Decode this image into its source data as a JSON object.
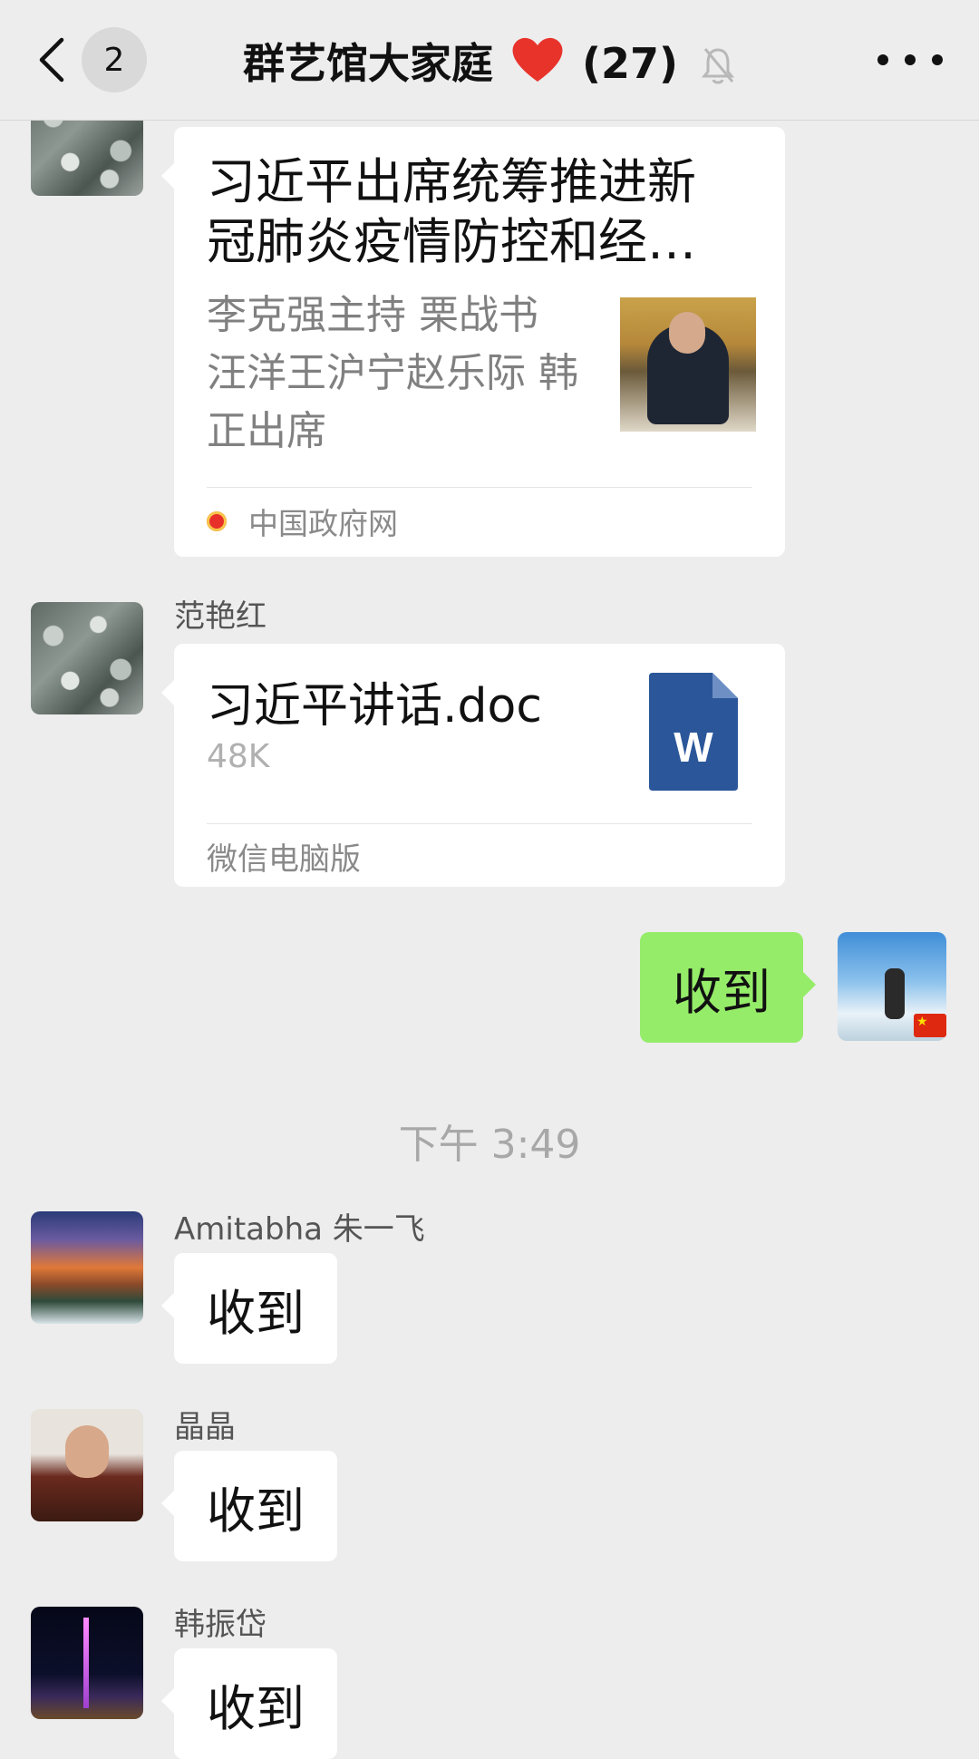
{
  "header": {
    "unread_count": "2",
    "title": "群艺馆大家庭",
    "member_count": "(27)"
  },
  "messages": {
    "article": {
      "title": "习近平出席统筹推进新冠肺炎疫情防控和经…",
      "description": "李克强主持 栗战书 汪洋王沪宁赵乐际 韩正出席",
      "source": "中国政府网"
    },
    "file": {
      "sender": "范艳红",
      "name": "习近平讲话.doc",
      "size": "48K",
      "source": "微信电脑版",
      "icon_letter": "W"
    },
    "my_reply": {
      "text": "收到"
    },
    "timestamp": "下午 3:49",
    "replies": [
      {
        "sender": "Amitabha 朱一飞",
        "text": "收到"
      },
      {
        "sender": "晶晶",
        "text": "收到"
      },
      {
        "sender": "韩振岱",
        "text": "收到"
      }
    ]
  },
  "colors": {
    "background": "#ededed",
    "my_bubble": "#95ec69",
    "word_icon": "#2b579a"
  }
}
